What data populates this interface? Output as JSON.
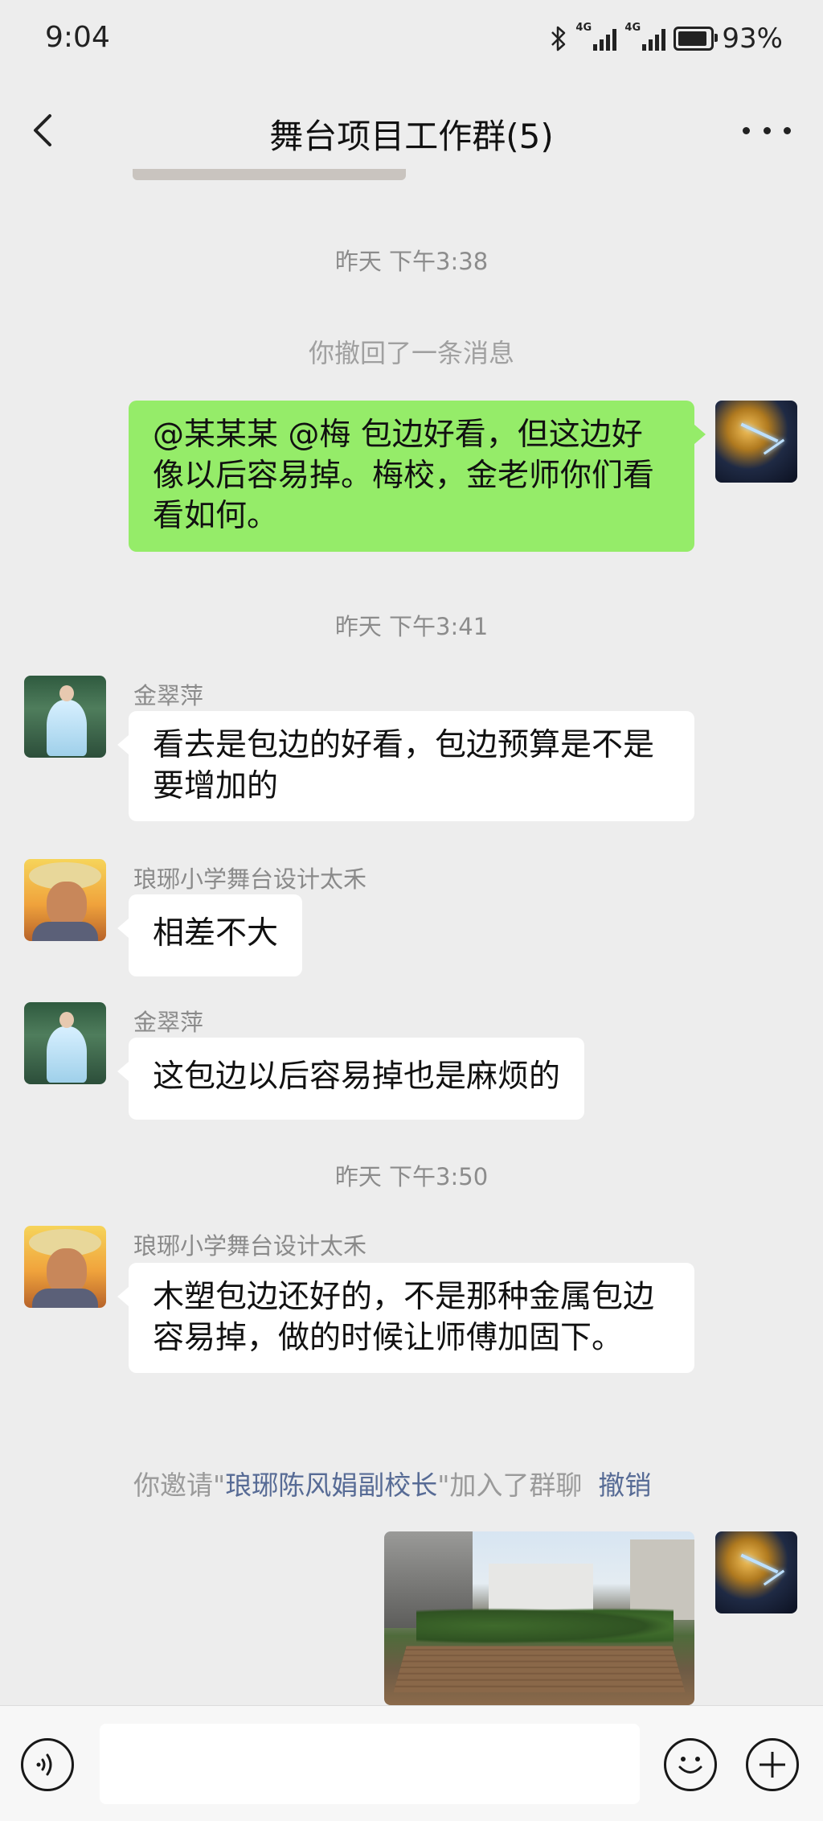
{
  "status_bar": {
    "time": "9:04",
    "network_1": "4G",
    "network_2": "4G",
    "battery": "93%",
    "battery_level": 0.93
  },
  "header": {
    "title": "舞台项目工作群(5)",
    "back_icon": "chevron-left-icon",
    "more_icon": "more-dots-icon"
  },
  "chat": {
    "timestamps": [
      "昨天 下午3:38",
      "昨天 下午3:41",
      "昨天 下午3:50"
    ],
    "recall_notice": "你撤回了一条消息",
    "messages": [
      {
        "sender": "",
        "side": "out",
        "text": "@某某某  @梅   包边好看，但这边好像以后容易掉。梅校，金老师你们看看如何。"
      },
      {
        "sender": "金翠萍",
        "side": "in",
        "text": "看去是包边的好看，包边预算是不是要增加的"
      },
      {
        "sender": "琅琊小学舞台设计太禾",
        "side": "in",
        "text": "相差不大"
      },
      {
        "sender": "金翠萍",
        "side": "in",
        "text": "这包边以后容易掉也是麻烦的"
      },
      {
        "sender": "琅琊小学舞台设计太禾",
        "side": "in",
        "text": "木塑包边还好的，不是那种金属包边容易掉，做的时候让师傅加固下。"
      }
    ],
    "invite": {
      "prefix": "你邀请\"",
      "name": "琅琊陈风娟副校长",
      "suffix": "\"加入了群聊",
      "undo": "撤销"
    }
  },
  "input_bar": {
    "voice_icon": "voice-icon",
    "input_value": "",
    "emoji_icon": "emoji-icon",
    "plus_icon": "plus-icon"
  }
}
